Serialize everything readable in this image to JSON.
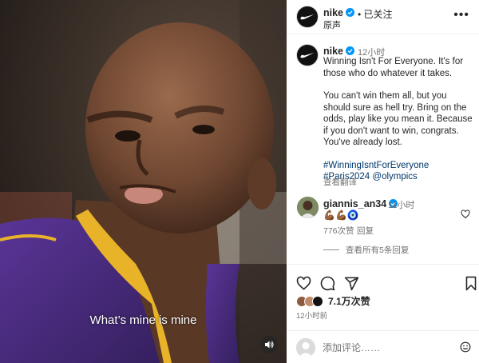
{
  "media": {
    "caption": "What’s mine is mine",
    "volume_icon": "volume-icon"
  },
  "header": {
    "username": "nike",
    "separator": "•",
    "follow_status": "已关注",
    "subtitle": "原声",
    "more_icon": "more-icon"
  },
  "post": {
    "username": "nike",
    "time": "12小时",
    "paragraphs": [
      "Winning Isn't For Everyone. It's for those who do whatever it takes.",
      "You can't win them all, but you should sure as hell try. Bring on the odds, play like you mean it. Because if you don't want to win, congrats. You've already lost."
    ],
    "hashtags": [
      "#WinningIsntForEveryone",
      "#Paris2024"
    ],
    "mention": "@olympics",
    "translate": "查看翻译"
  },
  "comment": {
    "username": "giannis_an34",
    "time": "11小时",
    "text": "💪🏾💪🏾🧿",
    "likes": "776次赞",
    "reply": "回复",
    "view_replies": "查看所有5条回复"
  },
  "actions": {
    "like_icon": "heart-icon",
    "comment_icon": "comment-icon",
    "share_icon": "share-icon",
    "save_icon": "bookmark-icon",
    "likes": "7.1万次赞",
    "post_time": "12小时前"
  },
  "add_comment": {
    "placeholder": "添加评论……",
    "emoji_icon": "emoji-icon"
  },
  "colors": {
    "verified": "#0095f6",
    "link": "#00376b",
    "secondary_text": "#737373",
    "jersey": "#4b2a86",
    "jersey_trim": "#e8b328"
  }
}
